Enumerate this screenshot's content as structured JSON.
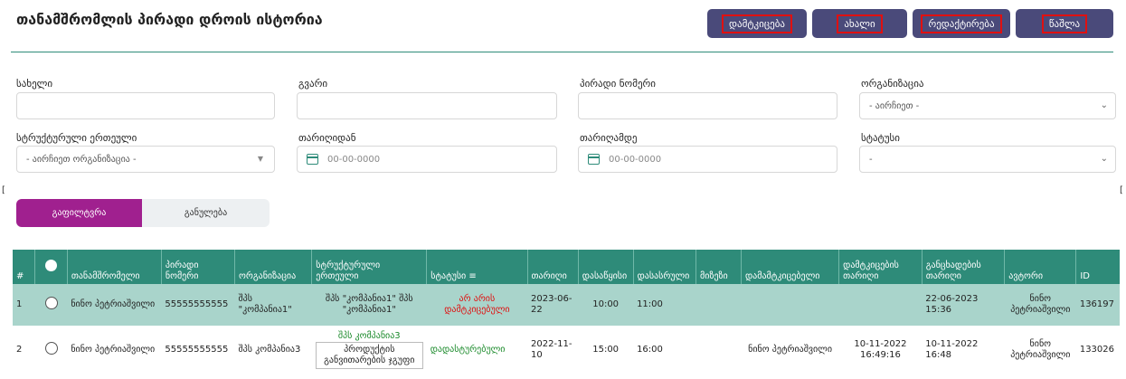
{
  "page": {
    "title": "თანამშრომლის პირადი დროის ისტორია"
  },
  "actions": {
    "approve": "დამტკიცება",
    "new": "ახალი",
    "edit": "რედაქტირება",
    "delete": "წაშლა"
  },
  "filters": {
    "first_name": {
      "label": "სახელი",
      "value": ""
    },
    "last_name": {
      "label": "გვარი",
      "value": ""
    },
    "personal_no": {
      "label": "პირადი ნომერი",
      "value": ""
    },
    "organization": {
      "label": "ორგანიზაცია",
      "value": "- აირჩიეთ -"
    },
    "structural_unit": {
      "label": "სტრუქტურული ერთეული",
      "value": "- აირჩიეთ ორგანიზაცია -"
    },
    "date_from": {
      "label": "თარიღიდან",
      "placeholder": "00-00-0000"
    },
    "date_to": {
      "label": "თარიღამდე",
      "placeholder": "00-00-0000"
    },
    "status": {
      "label": "სტატუსი",
      "value": "-"
    }
  },
  "buttons": {
    "filter": "გაფილტვრა",
    "reset": "განულება"
  },
  "table": {
    "columns": [
      "#",
      "",
      "თანამშრომელი",
      "პირადი ნომერი",
      "ორგანიზაცია",
      "სტრუქტურული ერთეული",
      "სტატუსი",
      "თარიღი",
      "დასაწყისი",
      "დასასრული",
      "მიზეზი",
      "დამამტკიცებელი",
      "დამტკიცების თარიღი",
      "განცხადების თარიღი",
      "ავტორი",
      "ID"
    ],
    "rows": [
      {
        "num": "1",
        "employee": "ნინო პეტრიაშვილი",
        "personal_no": "55555555555",
        "organization": "შპს \"კომპანია1\"",
        "unit": "შპს \"კომპანია1\" შპს \"კომპანია1\"",
        "status": "არ არის დამტკიცებული",
        "date": "2023-06-22",
        "start": "10:00",
        "end": "11:00",
        "reason": "",
        "approver": "",
        "approval_date": "",
        "application_date": "22-06-2023 15:36",
        "author": "ნინო პეტრიაშვილი",
        "id": "136197"
      },
      {
        "num": "2",
        "employee": "ნინო პეტრიაშვილი",
        "personal_no": "55555555555",
        "organization": "შპს კომპანია3",
        "unit_top": "შპს კომპანია3",
        "unit_box": "პროდუქტის განვითარების ჯგუფი",
        "status": "დადასტურებული",
        "date": "2022-11-10",
        "start": "15:00",
        "end": "16:00",
        "reason": "",
        "approver": "ნინო პეტრიაშვილი",
        "approval_date": "10-11-2022 16:49:16",
        "application_date": "10-11-2022 16:48",
        "author": "ნინო პეტრიაშვილი",
        "id": "133026"
      }
    ]
  },
  "colors": {
    "accent": "#2e8b79",
    "filter_button": "#a0208f",
    "action_button": "#4a4a7a",
    "highlight_border": "#e01010"
  }
}
